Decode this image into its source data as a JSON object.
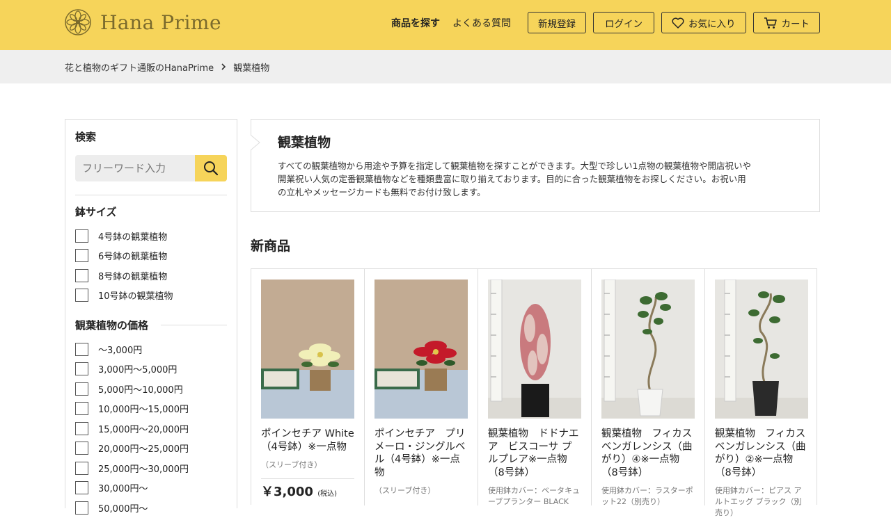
{
  "header": {
    "logo_text": "Hana Prime",
    "nav": {
      "search_products": "商品を探す",
      "faq": "よくある質問",
      "register": "新規登録",
      "login": "ログイン",
      "favorites": "お気に入り",
      "cart": "カート"
    },
    "accent_color": "#f6d45a"
  },
  "breadcrumb": {
    "home": "花と植物のギフト通販のHanaPrime",
    "current": "観葉植物"
  },
  "sidebar": {
    "search_title": "検索",
    "search_placeholder": "フリーワード入力",
    "pot_size_title": "鉢サイズ",
    "pot_sizes": [
      "4号鉢の観葉植物",
      "6号鉢の観葉植物",
      "8号鉢の観葉植物",
      "10号鉢の観葉植物"
    ],
    "price_title": "観葉植物の価格",
    "prices": [
      "〜3,000円",
      "3,000円〜5,000円",
      "5,000円〜10,000円",
      "10,000円〜15,000円",
      "15,000円〜20,000円",
      "20,000円〜25,000円",
      "25,000円〜30,000円",
      "30,000円〜",
      "50,000円〜"
    ]
  },
  "intro": {
    "title": "観葉植物",
    "line1": "すべての観葉植物から用途や予算を指定して観葉植物を探すことができます。大型で珍しい1点物の観葉植物や開店祝いや",
    "line2": "開業祝い人気の定番観葉植物などを種類豊富に取り揃えております。目的に合った観葉植物をお探しください。お祝い用",
    "line3": "の立札やメッセージカードも無料でお付け致します。"
  },
  "new_products": {
    "title": "新商品",
    "items": [
      {
        "name": "ポインセチア White（4号鉢）※一点物",
        "note": "（スリーブ付き）",
        "price": "￥3,000",
        "tax": "(税込)",
        "image": "white-poinsettia"
      },
      {
        "name": "ポインセチア　プリメーロ・ジングルベル（4号鉢）※一点物",
        "note": "（スリーブ付き）",
        "price": "",
        "tax": "",
        "image": "red-poinsettia"
      },
      {
        "name": "観葉植物　ドドナエア　ビスコーサ プルプレア※一点物（8号鉢）",
        "note": "使用鉢カバー：ベータキューブプランター BLACK",
        "price": "",
        "tax": "",
        "image": "dodonaea"
      },
      {
        "name": "観葉植物　フィカス ベンガレンシス（曲がり）④※一点物（8号鉢）",
        "note": "使用鉢カバー：ラスターポット22（別売り）",
        "price": "",
        "tax": "",
        "image": "ficus-white-pot"
      },
      {
        "name": "観葉植物　フィカス ベンガレンシス（曲がり）②※一点物（8号鉢）",
        "note": "使用鉢カバー：ピアス アルトエッグ ブラック（別売り）",
        "price": "",
        "tax": "",
        "image": "ficus-black-pot"
      }
    ]
  }
}
